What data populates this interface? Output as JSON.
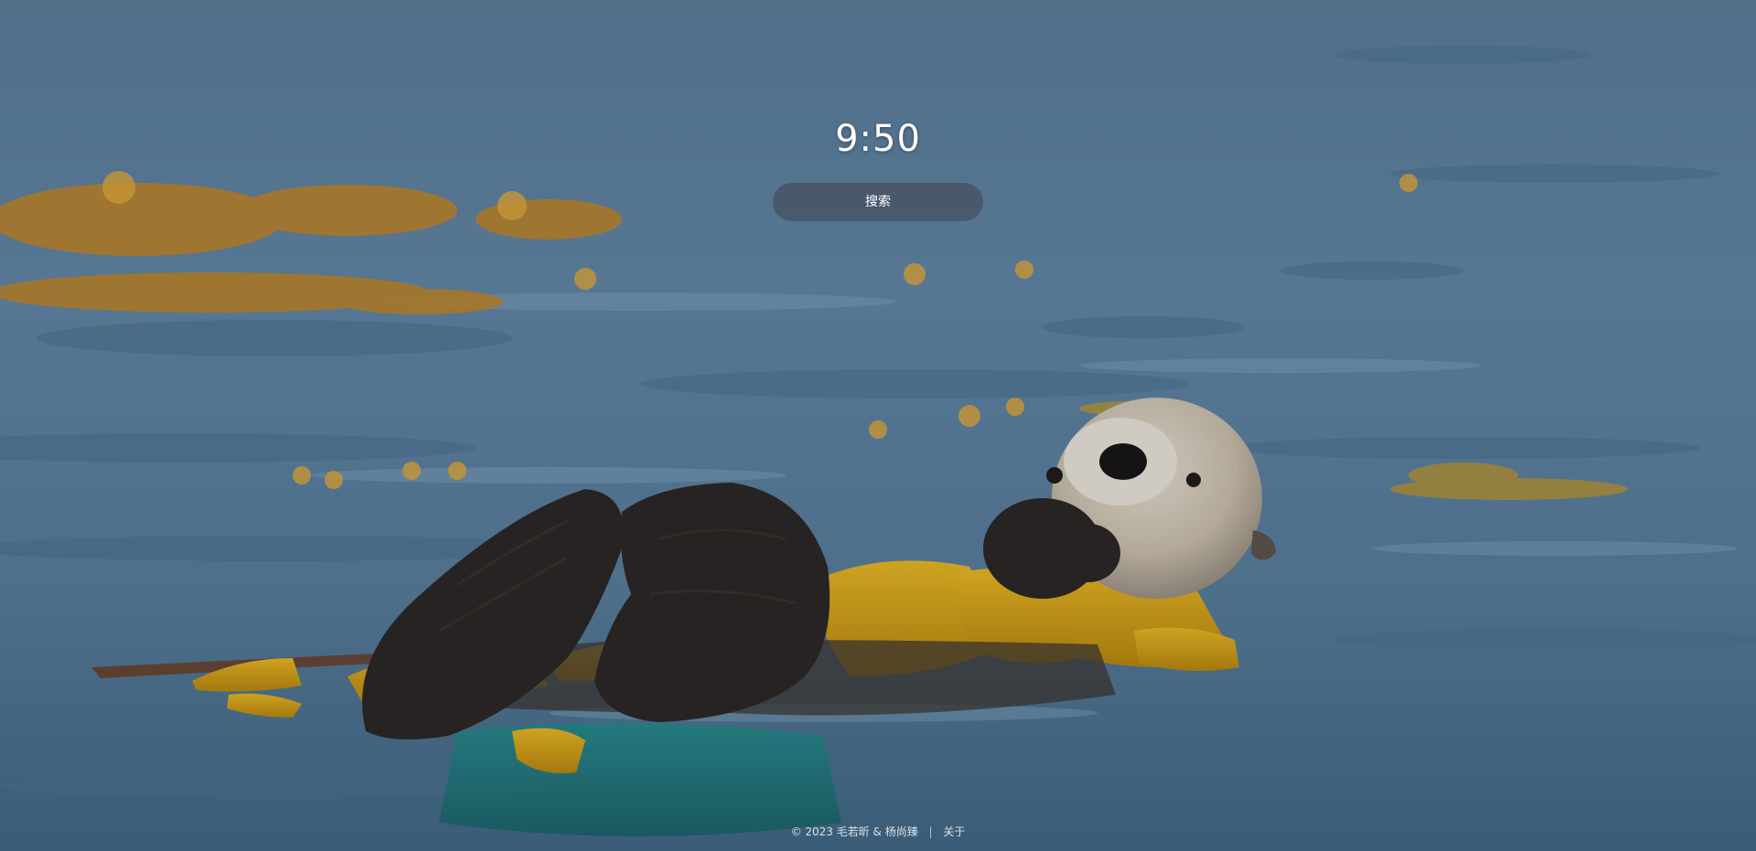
{
  "clock": {
    "time": "9:50"
  },
  "search": {
    "label": "搜索"
  },
  "footer": {
    "copyright": "© 2023 毛若昕 & 杨尚臻",
    "separator": "|",
    "about_label": "关于"
  },
  "background": {
    "description_icon": "sea-otter-wallpaper",
    "water_color": "#5d7f9c",
    "kelp_color": "#d9a416",
    "otter_color": "#2a2420"
  }
}
